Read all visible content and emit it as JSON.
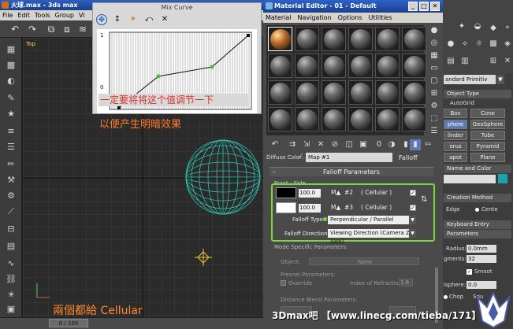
{
  "max_window": {
    "title": "火球.max - 3ds max",
    "menu": [
      "File",
      "Edit",
      "Tools",
      "Group",
      "Vi"
    ]
  },
  "viewport": {
    "label": "Top",
    "time_slider": "0 / 100"
  },
  "mix_curve": {
    "title": "Mix Curve",
    "axis_top": "1",
    "axis_bottom": "0",
    "note_1": "一定要将将这个值调节一下",
    "note_2": "以便产生明暗效果"
  },
  "material_editor": {
    "title": "Material Editor - 01 - Default",
    "menu": [
      "Material",
      "Navigation",
      "Options",
      "Utilities"
    ],
    "diffuse_label": "Diffuse Color:",
    "map_name": "Map #1",
    "map_type": "Falloff",
    "rollout_title": "Falloff Parameters",
    "front_side_label": "Front : Side",
    "rows": [
      {
        "amount": "100.0",
        "map": "#2",
        "type": "( Cellular )"
      },
      {
        "amount": "100.0",
        "map": "#3",
        "type": "( Cellular )"
      }
    ],
    "falloff_type_label": "Falloff Type:",
    "falloff_type_value": "Perpendicular / Parallel",
    "falloff_direction_label": "Falloff Direction:",
    "falloff_direction_value": "Viewing Direction (Camera Z-Axis)",
    "mode_title": "Mode Specific Parameters:",
    "object_label": "Object:",
    "object_value": "None",
    "fresnel_title": "Fresnel Parameters:",
    "override_label": "Override",
    "ior_label": "Index of Refraction",
    "ior_value": "1.6",
    "distance_title": "Distance Blend Parameters:"
  },
  "command_panel": {
    "category": "andard Primitiv",
    "object_type": "Object Type",
    "autogrid": "AutoGrid",
    "buttons": [
      "Box",
      "Cone",
      "phere",
      "GeoSphere",
      "linder",
      "Tube",
      "orus",
      "Pyramid",
      "apot",
      "Plane"
    ],
    "name_color": "Name and Color",
    "creation_method": "Creation Method",
    "edge": "Edge",
    "center": "Cente",
    "keyboard_entry": "Keyboard Entry",
    "parameters": "Parameters",
    "radius_label": "Radius:",
    "radius_value": "0.0mm",
    "segments_label": "gments:",
    "segments_value": "32",
    "smooth_label": "Smoot",
    "hemisphere_label": "isphere:",
    "hemisphere_value": "0.0",
    "chop_label": "Chop",
    "squash_label": "Squ"
  },
  "overlays": {
    "bottom_note": "兩個都給 Cellular",
    "watermark": "3Dmax吧 【www.linecg.com/tieba/171】"
  }
}
